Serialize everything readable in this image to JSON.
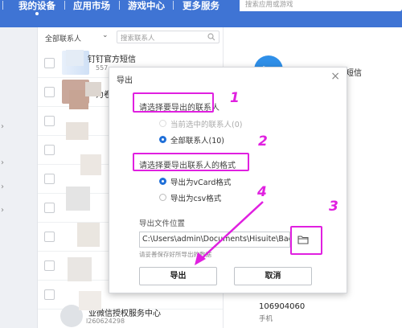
{
  "nav": {
    "items": [
      "我的设备",
      "应用市场",
      "游戏中心",
      "更多服务"
    ],
    "search_placeholder": "搜索应用或游戏"
  },
  "contacts": {
    "filter_label": "全部联系人",
    "search_placeholder": "搜索联系人",
    "rows": [
      {
        "name": "钉钉官方短信",
        "sub": "557"
      },
      {
        "name": "为卷",
        "sub": ""
      },
      {
        "name": "",
        "sub": ""
      },
      {
        "name": "",
        "sub": ""
      },
      {
        "name": "",
        "sub": ""
      },
      {
        "name": "",
        "sub": ""
      },
      {
        "name": "",
        "sub": ""
      },
      {
        "name": "",
        "sub": ""
      },
      {
        "name": "",
        "sub": ""
      },
      {
        "name": "",
        "sub": ""
      },
      {
        "name": "业微信授权服务中心",
        "sub": "l260624298"
      }
    ]
  },
  "detail": {
    "top_name": "短信",
    "bottom_number": "10690406​0",
    "bottom_label": "手机"
  },
  "dialog": {
    "title": "导出",
    "section1_label": "请选择要导出的联系人",
    "option_selected_contacts": "当前选中的联系人(0)",
    "option_all_contacts": "全部联系人(10)",
    "section2_label": "请选择要导出联系人的格式",
    "option_vcard": "导出为vCard格式",
    "option_csv": "导出为csv格式",
    "location_label": "导出文件位置",
    "path_value": "C:\\Users\\admin\\Documents\\Hisuite\\Backup",
    "hint": "请妥善保存好所导出的数据",
    "export_button": "导出",
    "cancel_button": "取消"
  },
  "annotations": {
    "numbers": [
      "1",
      "2",
      "3",
      "4"
    ],
    "color": "#e020e0"
  }
}
